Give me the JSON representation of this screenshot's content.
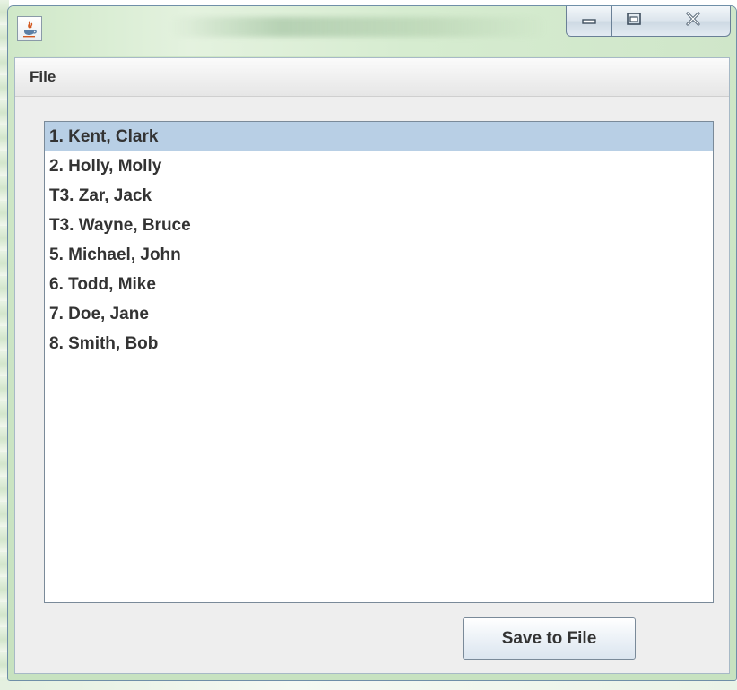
{
  "window": {
    "title": "",
    "icons": {
      "app": "java-app-icon",
      "minimize": "minimize-icon",
      "maximize": "maximize-icon",
      "close": "close-icon"
    },
    "accent_color": "#b8cfe5"
  },
  "menubar": {
    "file_label": "File"
  },
  "list": {
    "items": [
      {
        "label": "1. Kent, Clark",
        "selected": true
      },
      {
        "label": "2. Holly, Molly",
        "selected": false
      },
      {
        "label": "T3. Zar, Jack",
        "selected": false
      },
      {
        "label": "T3. Wayne, Bruce",
        "selected": false
      },
      {
        "label": "5. Michael, John",
        "selected": false
      },
      {
        "label": "6. Todd, Mike",
        "selected": false
      },
      {
        "label": "7. Doe, Jane",
        "selected": false
      },
      {
        "label": "8. Smith, Bob",
        "selected": false
      }
    ]
  },
  "actions": {
    "save_label": "Save to File"
  }
}
